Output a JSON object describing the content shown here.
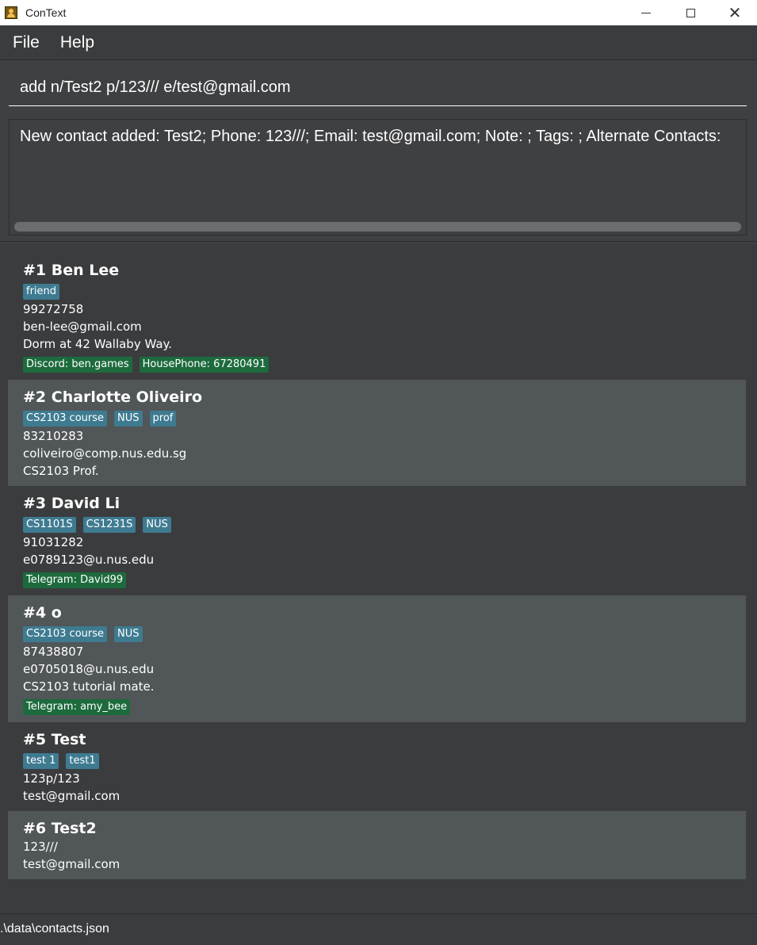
{
  "window": {
    "title": "ConText"
  },
  "menu": [
    "File",
    "Help"
  ],
  "command": {
    "value": "add n/Test2 p/123/// e/test@gmail.com"
  },
  "result": {
    "text": "New contact added: Test2; Phone: 123///; Email: test@gmail.com; Note: ; Tags: ; Alternate Contacts:"
  },
  "contacts": [
    {
      "name": "#1 Ben Lee",
      "tags": [
        "friend"
      ],
      "phone": "99272758",
      "email": "ben-lee@gmail.com",
      "note": "Dorm at 42 Wallaby Way.",
      "alternates": [
        "Discord: ben.games",
        "HousePhone: 67280491"
      ]
    },
    {
      "name": "#2 Charlotte Oliveiro",
      "tags": [
        "CS2103 course",
        "NUS",
        "prof"
      ],
      "phone": "83210283",
      "email": "coliveiro@comp.nus.edu.sg",
      "note": "CS2103 Prof.",
      "alternates": []
    },
    {
      "name": "#3 David Li",
      "tags": [
        "CS1101S",
        "CS1231S",
        "NUS"
      ],
      "phone": "91031282",
      "email": "e0789123@u.nus.edu",
      "note": "",
      "alternates": [
        "Telegram: David99"
      ]
    },
    {
      "name": "#4 o",
      "tags": [
        "CS2103 course",
        "NUS"
      ],
      "phone": "87438807",
      "email": "e0705018@u.nus.edu",
      "note": "CS2103 tutorial mate.",
      "alternates": [
        "Telegram: amy_bee"
      ]
    },
    {
      "name": "#5 Test",
      "tags": [
        "test 1",
        "test1"
      ],
      "phone": "123p/123",
      "email": "test@gmail.com",
      "note": "",
      "alternates": []
    },
    {
      "name": "#6 Test2",
      "tags": [],
      "phone": "123///",
      "email": "test@gmail.com",
      "note": "",
      "alternates": []
    }
  ],
  "status": {
    "path": ".\\data\\contacts.json"
  },
  "colors": {
    "tag": "#3e7b91",
    "alternate": "#1d6b3d",
    "card_alt": "#515658",
    "background": "#3f4042"
  }
}
